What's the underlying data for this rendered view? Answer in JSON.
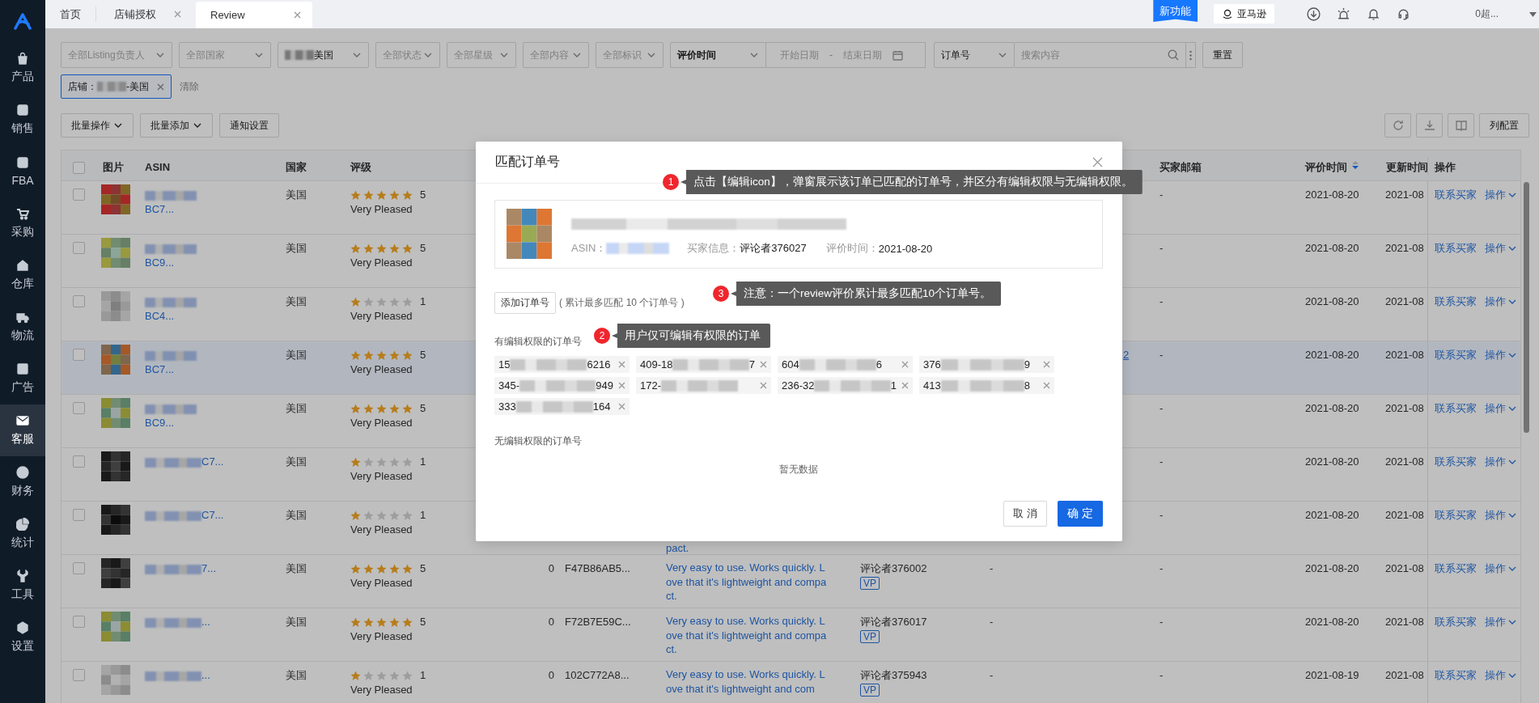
{
  "sidebar": {
    "items": [
      {
        "label": "产品",
        "selected": false
      },
      {
        "label": "销售",
        "selected": false
      },
      {
        "label": "FBA",
        "selected": false
      },
      {
        "label": "采购",
        "selected": false
      },
      {
        "label": "仓库",
        "selected": false
      },
      {
        "label": "物流",
        "selected": false
      },
      {
        "label": "广告",
        "selected": false
      },
      {
        "label": "客服",
        "selected": true
      },
      {
        "label": "财务",
        "selected": false
      },
      {
        "label": "统计",
        "selected": false
      },
      {
        "label": "工具",
        "selected": false
      },
      {
        "label": "设置",
        "selected": false
      }
    ]
  },
  "tabs": [
    {
      "label": "首页",
      "selected": false,
      "closable": false
    },
    {
      "label": "店铺授权",
      "selected": false,
      "closable": true
    },
    {
      "label": "Review",
      "selected": true,
      "closable": true
    }
  ],
  "header": {
    "new_feature_badge": "新功能",
    "marketplace_button": "亚马逊",
    "account": "0超..."
  },
  "filters": [
    {
      "kind": "select",
      "placeholder": "全部Listing负责人"
    },
    {
      "kind": "select",
      "placeholder": "全部国家"
    },
    {
      "kind": "select",
      "value": "美国",
      "redacted": true
    },
    {
      "kind": "select",
      "placeholder": "全部状态"
    },
    {
      "kind": "select",
      "placeholder": "全部星级"
    },
    {
      "kind": "select",
      "placeholder": "全部内容"
    },
    {
      "kind": "select",
      "placeholder": "全部标识"
    },
    {
      "kind": "select",
      "value": "评价时间"
    },
    {
      "kind": "date_range",
      "start_placeholder": "开始日期",
      "separator": "-",
      "end_placeholder": "结束日期"
    },
    {
      "kind": "search",
      "field": "订单号",
      "placeholder": "搜索内容"
    },
    {
      "kind": "button",
      "label": "重置"
    }
  ],
  "active_filters": {
    "tags": [
      {
        "prefix": "店铺：",
        "suffix": "-美国"
      }
    ],
    "clear_link": "清除"
  },
  "toolbar": {
    "buttons": [
      {
        "label": "批量操作",
        "dropdown": true
      },
      {
        "label": "批量添加",
        "dropdown": true
      },
      {
        "label": "通知设置",
        "dropdown": false
      }
    ],
    "column_config": "列配置"
  },
  "table": {
    "all_checked": false,
    "columns": [
      {
        "label": "图片",
        "sorted": false
      },
      {
        "kind": "asin",
        "label": "ASIN",
        "sorted": false
      },
      {
        "kind": "country",
        "label": "国家",
        "sorted": false
      },
      {
        "kind": "rating",
        "label": "评级",
        "sorted": false
      },
      {
        "kind": "buyer_email",
        "label": "买家邮箱",
        "sorted": false
      },
      {
        "kind": "review_time",
        "label": "评价时间",
        "sorted": true
      },
      {
        "kind": "update_time",
        "label": "更新时间",
        "sorted": false
      },
      {
        "kind": "actions",
        "label": "操作",
        "sorted": false
      }
    ],
    "rows": [
      {
        "checked": false,
        "highlighted": false,
        "asin": "BC7...",
        "country": "美国",
        "stars": 5,
        "rating": "5",
        "rating_text": "Very Pleased",
        "buyer_email": "-",
        "review_time": "2021-08-20",
        "update_time": "2021-08",
        "contact": "联系买家",
        "action": "操作"
      },
      {
        "checked": false,
        "highlighted": false,
        "asin": "BC9...",
        "country": "美国",
        "stars": 5,
        "rating": "5",
        "rating_text": "Very Pleased",
        "buyer_email": "-",
        "review_time": "2021-08-20",
        "update_time": "2021-08",
        "contact": "联系买家",
        "action": "操作"
      },
      {
        "checked": false,
        "highlighted": false,
        "asin": "BC4...",
        "country": "美国",
        "stars": 1,
        "rating": "1",
        "rating_text": "Very Pleased",
        "buyer_email": "-",
        "review_time": "2021-08-20",
        "update_time": "2021-08",
        "contact": "联系买家",
        "action": "操作"
      },
      {
        "checked": false,
        "highlighted": true,
        "asin": "BC7...",
        "country": "美国",
        "stars": 5,
        "rating": "5",
        "rating_text": "Very Pleased",
        "column_10": "2",
        "buyer_email": "-",
        "review_time": "2021-08-20",
        "update_time": "2021-08",
        "contact": "联系买家",
        "action": "操作"
      },
      {
        "checked": false,
        "highlighted": false,
        "asin": "BC9...",
        "country": "美国",
        "stars": 5,
        "rating": "5",
        "rating_text": "Very Pleased",
        "buyer_email": "-",
        "review_time": "2021-08-20",
        "update_time": "2021-08",
        "contact": "联系买家",
        "action": "操作"
      },
      {
        "checked": false,
        "highlighted": false,
        "asin": "C7...",
        "country": "美国",
        "stars": 1,
        "rating": "1",
        "rating_text": "Very Pleased",
        "buyer_email": "-",
        "review_time": "2021-08-20",
        "update_time": "2021-08",
        "contact": "联系买家",
        "action": "操作"
      },
      {
        "checked": false,
        "highlighted": false,
        "asin": "C7...",
        "country": "美国",
        "stars": 1,
        "rating": "1",
        "rating_text": "Very Pleased",
        "content_tail": "pact.",
        "buyer_email": "-",
        "review_time": "2021-08-20",
        "update_time": "2021-08",
        "contact": "联系买家",
        "action": "操作"
      },
      {
        "checked": false,
        "highlighted": false,
        "asin": "7...",
        "country": "美国",
        "stars": 5,
        "rating": "5",
        "rating_text": "Very Pleased",
        "count": "0",
        "order_id": "F47B86AB5...",
        "content": "Very easy to use. Works quickly. Love that it's lightweight and compact.",
        "reviewer": "评论者376002",
        "vp": "VP",
        "column_9": "-",
        "buyer_email": "-",
        "review_time": "2021-08-20",
        "update_time": "2021-08",
        "contact": "联系买家",
        "action": "操作"
      },
      {
        "checked": false,
        "highlighted": false,
        "asin": "...",
        "country": "美国",
        "stars": 5,
        "rating": "5",
        "rating_text": "Very Pleased",
        "count": "0",
        "order_id": "F72B7E59C...",
        "content": "Very easy to use. Works quickly. Love that it's lightweight and compact.",
        "reviewer": "评论者376017",
        "vp": "VP",
        "column_9": "-",
        "buyer_email": "-",
        "review_time": "2021-08-20",
        "update_time": "2021-08",
        "contact": "联系买家",
        "action": "操作"
      },
      {
        "checked": false,
        "highlighted": false,
        "asin": "...",
        "country": "美国",
        "stars": 1,
        "rating": "1",
        "rating_text": "Very Pleased",
        "count": "0",
        "order_id": "102C772A8...",
        "content": "Very easy to use. Works quickly. Love that it's lightweight and com",
        "reviewer": "评论者375943",
        "vp": "VP",
        "column_9": "-",
        "buyer_email": "-",
        "review_time": "2021-08-19",
        "update_time": "2021-08",
        "contact": "联系买家",
        "action": "操作"
      }
    ]
  },
  "modal": {
    "title": "匹配订单号",
    "product": {
      "asin_label": "ASIN：",
      "buyer_label": "买家信息：",
      "buyer": "评论者376027",
      "time_label": "评价时间：",
      "time": "2021-08-20"
    },
    "add_button": "添加订单号",
    "limit_note": "( 累计最多匹配 10 个订单号 )",
    "editable_label": "有编辑权限的订单号",
    "editable_orders": [
      {
        "prefix": "15",
        "suffix": "6216"
      },
      {
        "prefix": "409-18",
        "suffix": "7"
      },
      {
        "prefix": "604",
        "suffix": "6"
      },
      {
        "prefix": "376",
        "suffix": "9"
      },
      {
        "prefix": "345-",
        "suffix": "949"
      },
      {
        "prefix": "172-"
      },
      {
        "prefix": "236-32",
        "suffix": "1"
      },
      {
        "prefix": "413",
        "suffix": "8"
      },
      {
        "prefix": "333",
        "suffix": "164"
      }
    ],
    "readonly_label": "无编辑权限的订单号",
    "empty_text": "暂无数据",
    "cancel_button": "取 消",
    "ok_button": "确 定"
  },
  "annotations": [
    {
      "number": "1",
      "text": "点击【编辑icon】，弹窗展示该订单已匹配的订单号，并区分有编辑权限与无编辑权限。"
    },
    {
      "number": "3",
      "text": "注意：一个review评价累计最多匹配10个订单号。"
    },
    {
      "number": "2",
      "text": "用户仅可编辑有权限的订单"
    }
  ]
}
